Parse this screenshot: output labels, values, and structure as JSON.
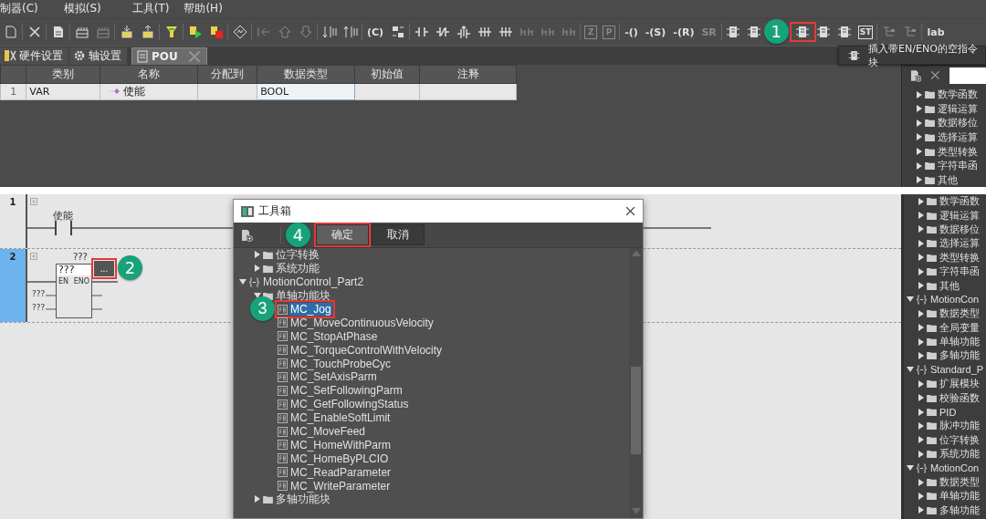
{
  "menu": [
    "制器(C)",
    "模拟(S)",
    "工具(T)",
    "帮助(H)"
  ],
  "toolbar": [
    [
      {
        "kind": "page",
        "disabled": false
      }
    ],
    [
      {
        "kind": "close",
        "disabled": false
      }
    ],
    [
      {
        "kind": "document",
        "disabled": false
      }
    ],
    [
      {
        "kind": "grid",
        "disabled": false
      },
      {
        "kind": "grid",
        "disabled": true
      }
    ],
    [
      {
        "kind": "transfer-down",
        "disabled": false
      },
      {
        "kind": "transfer-up",
        "disabled": false
      }
    ],
    [
      {
        "kind": "funnel",
        "disabled": false
      }
    ],
    [
      {
        "kind": "run",
        "disabled": false
      },
      {
        "kind": "stop",
        "disabled": false
      }
    ],
    [
      {
        "kind": "swap",
        "disabled": false
      }
    ],
    [
      {
        "kind": "branch",
        "disabled": true
      },
      {
        "kind": "arrow-up",
        "disabled": true
      },
      {
        "kind": "arrow-down",
        "disabled": true
      }
    ],
    [
      {
        "kind": "rails-down",
        "disabled": false
      },
      {
        "kind": "rails-up",
        "disabled": false
      }
    ],
    [
      {
        "kind": "text",
        "label": "(C)",
        "disabled": false
      },
      {
        "kind": "exchange",
        "disabled": false
      }
    ],
    [
      {
        "kind": "contact",
        "disabled": false
      },
      {
        "kind": "contact-nc",
        "disabled": false
      },
      {
        "kind": "contact-rise",
        "disabled": false
      },
      {
        "kind": "contact-multi",
        "disabled": false
      },
      {
        "kind": "contact-multi",
        "disabled": false
      },
      {
        "kind": "contact-split",
        "disabled": true
      },
      {
        "kind": "contact-split",
        "disabled": true
      },
      {
        "kind": "contact-split",
        "disabled": true
      }
    ],
    [
      {
        "kind": "boxed-text",
        "label": "Z",
        "disabled": true
      },
      {
        "kind": "boxed-text",
        "label": "P",
        "disabled": true
      }
    ],
    [
      {
        "kind": "text",
        "label": "-()",
        "disabled": false
      },
      {
        "kind": "text",
        "label": "-(S)",
        "disabled": false
      },
      {
        "kind": "text",
        "label": "-(R)",
        "disabled": false
      },
      {
        "kind": "text",
        "label": "SR",
        "disabled": true
      }
    ],
    [
      {
        "kind": "block",
        "disabled": false
      },
      {
        "kind": "block",
        "disabled": false
      },
      {
        "kind": "block",
        "disabled": false,
        "annotated": true,
        "callout": "1"
      },
      {
        "kind": "block",
        "disabled": false
      },
      {
        "kind": "block",
        "disabled": false
      },
      {
        "kind": "boxed-text",
        "label": "ST",
        "disabled": false
      }
    ],
    [
      {
        "kind": "tree",
        "disabled": true
      },
      {
        "kind": "tree",
        "disabled": true
      }
    ],
    [
      {
        "kind": "text",
        "label": "lab",
        "disabled": false
      }
    ]
  ],
  "tooltip": {
    "text": "插入带EN/ENO的空指令块"
  },
  "tabs": [
    {
      "label": "硬件设置",
      "kind": "hardware",
      "selected": false
    },
    {
      "label": "轴设置",
      "kind": "gear",
      "selected": false
    },
    {
      "label": "POU",
      "kind": "pou",
      "selected": true,
      "closable": true
    }
  ],
  "table": {
    "columns": [
      "类别",
      "名称",
      "分配到",
      "数据类型",
      "初始值",
      "注释"
    ],
    "rows": [
      {
        "number": "1",
        "cells": [
          {
            "text": "VAR",
            "selected": false
          },
          {
            "text": "使能",
            "selected": false
          },
          {
            "selected": false
          },
          {
            "text": "BOOL",
            "selected": true
          },
          {
            "selected": false
          },
          {
            "selected": false
          }
        ]
      }
    ]
  },
  "library_top": {
    "continued_children": [
      {
        "label": "数学函数",
        "kind": "folder",
        "expanded": false
      },
      {
        "label": "逻辑运算",
        "kind": "folder",
        "expanded": false
      },
      {
        "label": "数据移位",
        "kind": "folder",
        "expanded": false
      },
      {
        "label": "选择运算",
        "kind": "folder",
        "expanded": false
      },
      {
        "label": "类型转换",
        "kind": "folder",
        "expanded": false
      },
      {
        "label": "字符串函",
        "kind": "folder",
        "expanded": false
      },
      {
        "label": "其他",
        "kind": "folder",
        "expanded": false
      }
    ]
  },
  "ladder": {
    "rungs": [
      {
        "number": "1",
        "selected": false,
        "kind": "contact",
        "label": "使能"
      },
      {
        "number": "2",
        "selected": true,
        "kind": "block",
        "instance": "???",
        "name": "???",
        "enable_in": "EN",
        "enable_out": "ENO",
        "inputs": [
          "???",
          "???"
        ],
        "browse": {
          "label": "...",
          "annotated": true,
          "callout": "2"
        }
      }
    ]
  },
  "library_bottom": {
    "continued_children": [
      {
        "label": "数学函数",
        "kind": "folder",
        "expanded": false
      },
      {
        "label": "逻辑运算",
        "kind": "folder",
        "expanded": false
      },
      {
        "label": "数据移位",
        "kind": "folder",
        "expanded": false
      },
      {
        "label": "选择运算",
        "kind": "folder",
        "expanded": false
      },
      {
        "label": "类型转换",
        "kind": "folder",
        "expanded": false
      },
      {
        "label": "字符串函",
        "kind": "folder",
        "expanded": false
      },
      {
        "label": "其他",
        "kind": "folder",
        "expanded": false
      }
    ],
    "nodes": [
      {
        "label": "MotionCon",
        "kind": "library",
        "expanded": true,
        "children": [
          {
            "label": "数据类型",
            "kind": "folder",
            "expanded": false
          },
          {
            "label": "全局变量",
            "kind": "folder",
            "expanded": false
          },
          {
            "label": "单轴功能",
            "kind": "folder",
            "expanded": false
          },
          {
            "label": "多轴功能",
            "kind": "folder",
            "expanded": false
          }
        ]
      },
      {
        "label": "Standard_P",
        "kind": "library",
        "expanded": true,
        "children": [
          {
            "label": "扩展模块",
            "kind": "folder",
            "expanded": false
          },
          {
            "label": "校验函数",
            "kind": "folder",
            "expanded": false
          },
          {
            "label": "PID",
            "kind": "folder",
            "expanded": false
          },
          {
            "label": "脉冲功能",
            "kind": "folder",
            "expanded": false
          },
          {
            "label": "位字转换",
            "kind": "folder",
            "expanded": false
          },
          {
            "label": "系统功能",
            "kind": "folder",
            "expanded": false
          }
        ]
      },
      {
        "label": "MotionCon",
        "kind": "library",
        "expanded": true,
        "children": [
          {
            "label": "数据类型",
            "kind": "folder",
            "expanded": false
          },
          {
            "label": "单轴功能",
            "kind": "folder",
            "expanded": false
          },
          {
            "label": "多轴功能",
            "kind": "folder",
            "expanded": false
          }
        ]
      }
    ]
  },
  "dialog": {
    "title": "工具箱",
    "buttons": [
      {
        "label": "确定",
        "annotated": true,
        "callout": "4"
      },
      {
        "label": "取消",
        "annotated": false
      }
    ],
    "tree": {
      "continued_children": [
        {
          "label": "位字转换",
          "kind": "folder",
          "expanded": false,
          "selected": false
        },
        {
          "label": "系统功能",
          "kind": "folder",
          "expanded": false,
          "selected": false
        }
      ],
      "nodes": [
        {
          "label": "MotionControl_Part2",
          "kind": "library",
          "expanded": true,
          "selected": false,
          "children": [
            {
              "label": "单轴功能块",
              "kind": "folder",
              "expanded": true,
              "selected": false,
              "children": [
                {
                  "label": "MC_Jog",
                  "kind": "function-block",
                  "selected": true,
                  "annotated": true,
                  "callout": "3"
                },
                {
                  "label": "MC_MoveContinuousVelocity",
                  "kind": "function-block",
                  "selected": false
                },
                {
                  "label": "MC_StopAtPhase",
                  "kind": "function-block",
                  "selected": false
                },
                {
                  "label": "MC_TorqueControlWithVelocity",
                  "kind": "function-block",
                  "selected": false
                },
                {
                  "label": "MC_TouchProbeCyc",
                  "kind": "function-block",
                  "selected": false
                },
                {
                  "label": "MC_SetAxisParm",
                  "kind": "function-block",
                  "selected": false
                },
                {
                  "label": "MC_SetFollowingParm",
                  "kind": "function-block",
                  "selected": false
                },
                {
                  "label": "MC_GetFollowingStatus",
                  "kind": "function-block",
                  "selected": false
                },
                {
                  "label": "MC_EnableSoftLimit",
                  "kind": "function-block",
                  "selected": false
                },
                {
                  "label": "MC_MoveFeed",
                  "kind": "function-block",
                  "selected": false
                },
                {
                  "label": "MC_HomeWithParm",
                  "kind": "function-block",
                  "selected": false
                },
                {
                  "label": "MC_HomeByPLCIO",
                  "kind": "function-block",
                  "selected": false
                },
                {
                  "label": "MC_ReadParameter",
                  "kind": "function-block",
                  "selected": false
                },
                {
                  "label": "MC_WriteParameter",
                  "kind": "function-block",
                  "selected": false
                }
              ]
            },
            {
              "label": "多轴功能块",
              "kind": "folder",
              "expanded": false,
              "selected": false
            }
          ]
        }
      ]
    }
  }
}
